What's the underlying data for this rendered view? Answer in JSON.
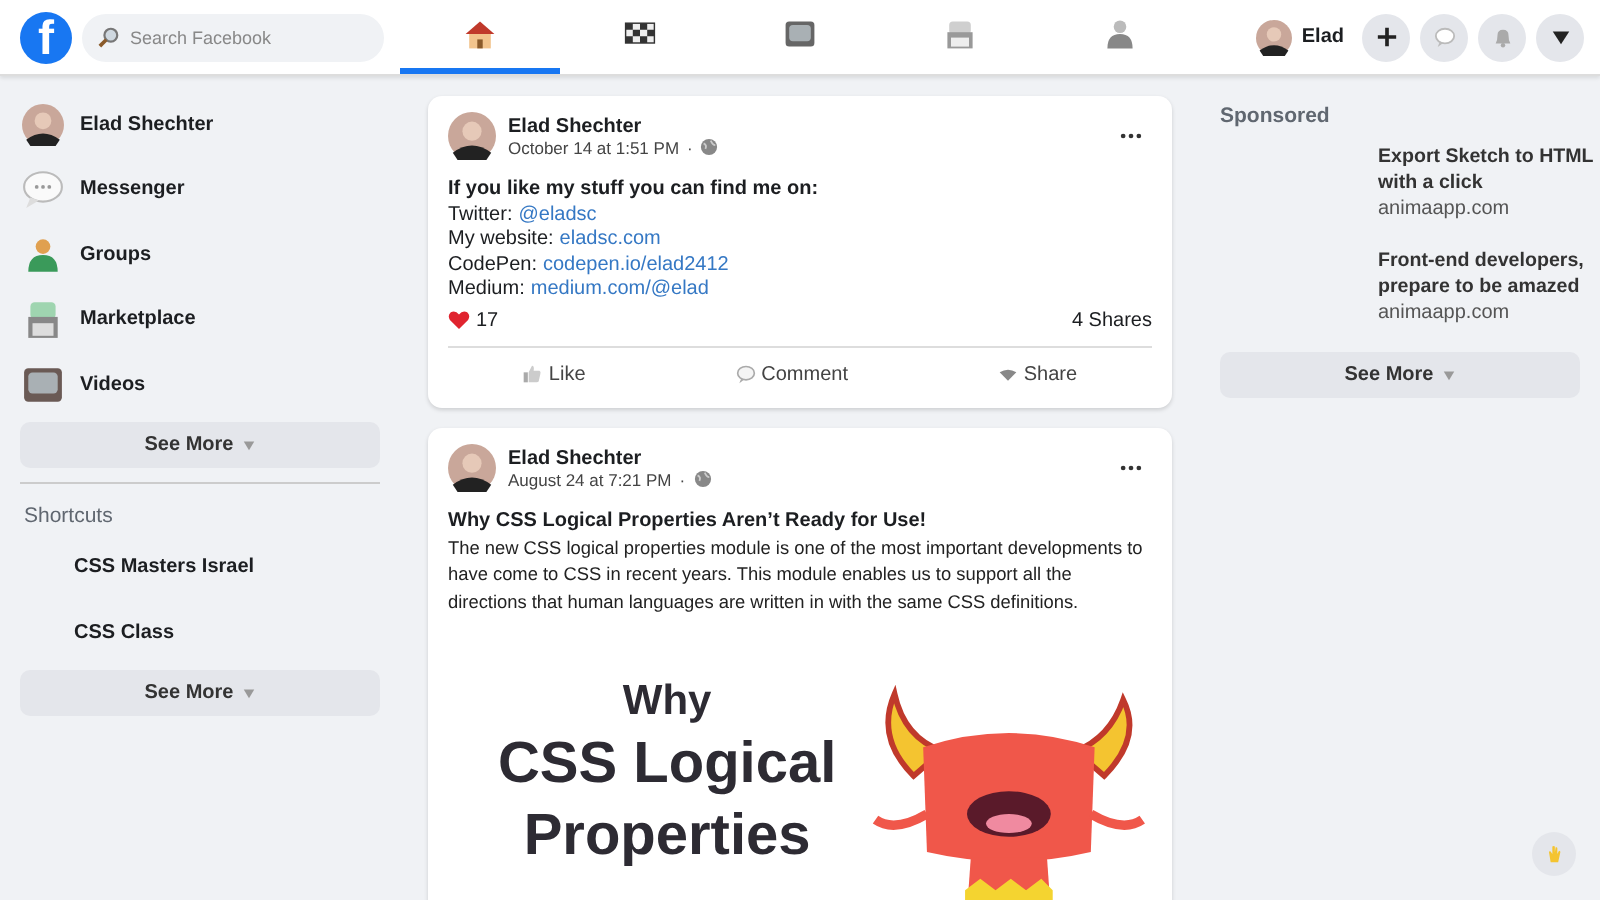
{
  "topbar": {
    "logo": "f",
    "search": {
      "placeholder": "Search Facebook"
    },
    "tabs": [
      {
        "kind": "home",
        "selected": true
      },
      {
        "kind": "flag",
        "selected": false
      },
      {
        "kind": "tv",
        "selected": false
      },
      {
        "kind": "store",
        "selected": false
      },
      {
        "kind": "person",
        "selected": false
      }
    ],
    "profile": {
      "name": "Elad"
    },
    "actions": [
      {
        "kind": "plus"
      },
      {
        "kind": "messenger"
      },
      {
        "kind": "bell"
      },
      {
        "kind": "caret"
      }
    ]
  },
  "sidebar": {
    "items": [
      {
        "label": "Elad Shechter",
        "kind": "avatar"
      },
      {
        "label": "Messenger",
        "kind": "messenger"
      },
      {
        "label": "Groups",
        "kind": "groups"
      },
      {
        "label": "Marketplace",
        "kind": "store"
      },
      {
        "label": "Videos",
        "kind": "tv"
      }
    ],
    "see_more": "See More",
    "shortcuts_title": "Shortcuts",
    "shortcuts": [
      "CSS Masters Israel",
      "CSS Class"
    ],
    "shortcuts_see_more": "See More"
  },
  "posts": [
    {
      "author": "Elad Shechter",
      "time": "October 14 at 1:51 PM",
      "separator": "·",
      "heading": "If you like my stuff you can find me on:",
      "lines": [
        {
          "label": "Twitter:",
          "link": "@eladsc"
        },
        {
          "label": "My website:",
          "link": "eladsc.com"
        },
        {
          "label": "CodePen:",
          "link": "codepen.io/elad2412"
        },
        {
          "label": "Medium:",
          "link": "medium.com/@elad"
        }
      ],
      "reactions": "17",
      "shares": "4 Shares",
      "actions": [
        {
          "kind": "like",
          "label": "Like"
        },
        {
          "kind": "comment",
          "label": "Comment"
        },
        {
          "kind": "share",
          "label": "Share"
        }
      ]
    },
    {
      "author": "Elad Shechter",
      "time": "August 24 at 7:21 PM",
      "separator": "·",
      "heading": "Why CSS Logical Properties Aren’t Ready for Use!",
      "text": "The new CSS logical properties module is one of the most important developments to have come to CSS in recent years. This module enables us to support all the directions that human languages are written in with the same CSS definitions.",
      "image": {
        "lines": [
          "Why",
          "CSS Logical",
          "Properties"
        ]
      }
    }
  ],
  "sponsored": {
    "title": "Sponsored",
    "ads": [
      {
        "title": "Export Sketch to HTML with a click",
        "domain": "animaapp.com"
      },
      {
        "title": "Front-end developers, prepare to be amazed",
        "domain": "animaapp.com"
      }
    ],
    "see_more": "See More"
  }
}
